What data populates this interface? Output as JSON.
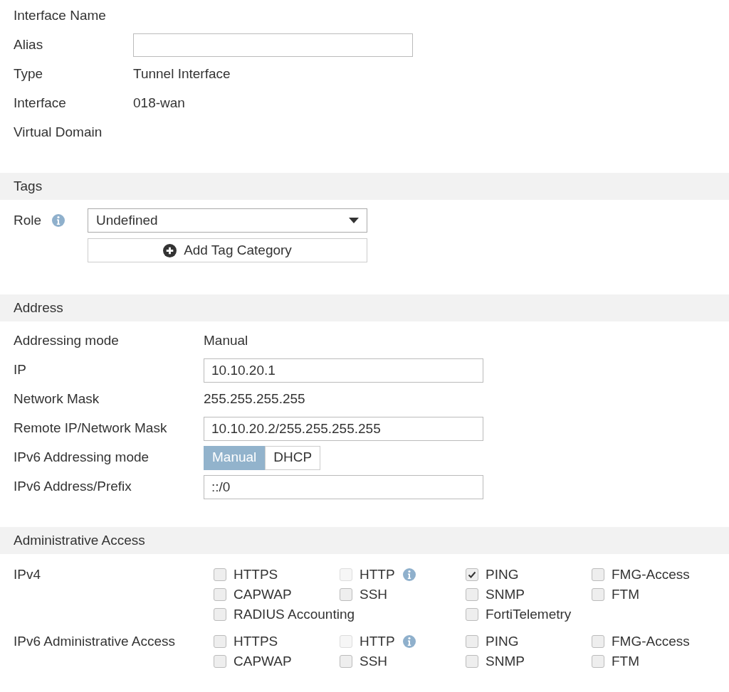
{
  "general": [
    {
      "kind": "text",
      "label": "Interface Name"
    },
    {
      "kind": "input",
      "label": "Alias"
    },
    {
      "kind": "text",
      "label": "Type",
      "value": "Tunnel Interface"
    },
    {
      "kind": "text",
      "label": "Interface",
      "value": "018-wan"
    },
    {
      "kind": "text",
      "label": "Virtual Domain"
    }
  ],
  "tags": {
    "title": "Tags",
    "role_label": "Role",
    "role_value": "Undefined",
    "add_button": "Add Tag Category"
  },
  "address": {
    "title": "Address",
    "rows": [
      {
        "kind": "text",
        "label": "Addressing mode",
        "value": "Manual"
      },
      {
        "kind": "input",
        "label": "IP",
        "value": "10.10.20.1"
      },
      {
        "kind": "text",
        "label": "Network Mask",
        "value": "255.255.255.255"
      },
      {
        "kind": "input",
        "label": "Remote IP/Network Mask",
        "value": "10.10.20.2/255.255.255.255"
      },
      {
        "kind": "toggle",
        "label": "IPv6 Addressing mode",
        "options": [
          {
            "label": "Manual",
            "selected": true
          },
          {
            "label": "DHCP",
            "selected": false
          }
        ]
      },
      {
        "kind": "input",
        "label": "IPv6 Address/Prefix",
        "value": "::/0"
      }
    ]
  },
  "admin": {
    "title": "Administrative Access",
    "groups": [
      {
        "label": "IPv4",
        "rows": [
          [
            {
              "label": "HTTPS",
              "checked": false,
              "disabled": false,
              "info": false
            },
            {
              "label": "HTTP",
              "checked": false,
              "disabled": true,
              "info": true
            },
            {
              "label": "PING",
              "checked": true,
              "disabled": false,
              "info": false
            },
            {
              "label": "FMG-Access",
              "checked": false,
              "disabled": false,
              "info": false
            }
          ],
          [
            {
              "label": "CAPWAP",
              "checked": false,
              "disabled": false,
              "info": false
            },
            {
              "label": "SSH",
              "checked": false,
              "disabled": false,
              "info": false
            },
            {
              "label": "SNMP",
              "checked": false,
              "disabled": false,
              "info": false
            },
            {
              "label": "FTM",
              "checked": false,
              "disabled": false,
              "info": false
            }
          ],
          [
            {
              "label": "RADIUS Accounting",
              "checked": false,
              "disabled": false,
              "info": false
            },
            "",
            {
              "label": "FortiTelemetry",
              "checked": false,
              "disabled": false,
              "info": false
            }
          ]
        ]
      },
      {
        "label": "IPv6 Administrative Access",
        "rows": [
          [
            {
              "label": "HTTPS",
              "checked": false,
              "disabled": false,
              "info": false
            },
            {
              "label": "HTTP",
              "checked": false,
              "disabled": true,
              "info": true
            },
            {
              "label": "PING",
              "checked": false,
              "disabled": false,
              "info": false
            },
            {
              "label": "FMG-Access",
              "checked": false,
              "disabled": false,
              "info": false
            }
          ],
          [
            {
              "label": "CAPWAP",
              "checked": false,
              "disabled": false,
              "info": false
            },
            {
              "label": "SSH",
              "checked": false,
              "disabled": false,
              "info": false
            },
            {
              "label": "SNMP",
              "checked": false,
              "disabled": false,
              "info": false
            },
            {
              "label": "FTM",
              "checked": false,
              "disabled": false,
              "info": false
            }
          ]
        ]
      }
    ]
  }
}
